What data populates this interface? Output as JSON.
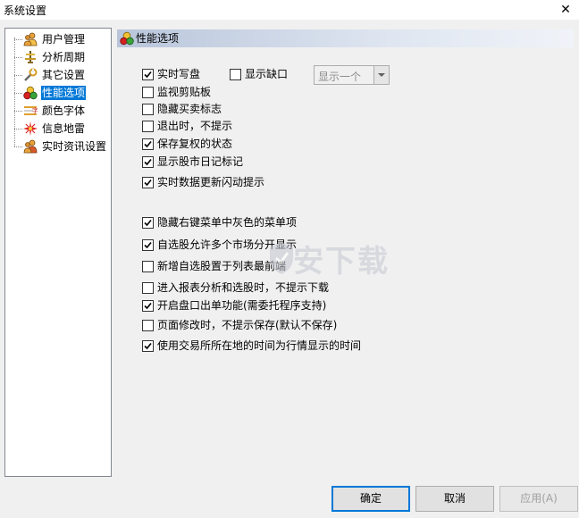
{
  "window": {
    "title": "系统设置",
    "close_label": "✕"
  },
  "tree": {
    "items": [
      {
        "label": "用户管理",
        "icon": "users-icon"
      },
      {
        "label": "分析周期",
        "icon": "cycle-icon"
      },
      {
        "label": "其它设置",
        "icon": "tools-icon"
      },
      {
        "label": "性能选项",
        "icon": "performance-icon",
        "selected": true
      },
      {
        "label": "颜色字体",
        "icon": "font-color-icon"
      },
      {
        "label": "信息地雷",
        "icon": "mine-icon"
      },
      {
        "label": "实时资讯设置",
        "icon": "news-users-icon"
      }
    ]
  },
  "panel": {
    "title": "性能选项"
  },
  "options": {
    "realtime_write": {
      "label": "实时写盘",
      "checked": true
    },
    "show_gaps": {
      "label": "显示缺口",
      "checked": false
    },
    "monitor_clipboard": {
      "label": "监视剪贴板",
      "checked": false
    },
    "hide_buysell": {
      "label": "隐藏买卖标志",
      "checked": false
    },
    "exit_no_prompt": {
      "label": "退出时，不提示",
      "checked": false
    },
    "save_restore_state": {
      "label": "保存复权的状态",
      "checked": true
    },
    "show_diary_mark": {
      "label": "显示股市日记标记",
      "checked": true
    },
    "flash_update": {
      "label": "实时数据更新闪动提示",
      "checked": true
    },
    "hide_gray_menu": {
      "label": "隐藏右键菜单中灰色的菜单项",
      "checked": true
    },
    "multi_market": {
      "label": "自选股允许多个市场分开显示",
      "checked": true
    },
    "new_to_front": {
      "label": "新增自选股置于列表最前端",
      "checked": false
    },
    "no_download_prompt": {
      "label": "进入报表分析和选股时，不提示下载",
      "checked": false
    },
    "order_function": {
      "label": "开启盘口出单功能(需委托程序支持)",
      "checked": true
    },
    "page_no_save": {
      "label": "页面修改时，不提示保存(默认不保存)",
      "checked": false
    },
    "exchange_time": {
      "label": "使用交易所所在地的时间为行情显示的时间",
      "checked": true
    }
  },
  "combo": {
    "value": "显示一个"
  },
  "buttons": {
    "ok": "确定",
    "cancel": "取消",
    "apply": "应用(A)"
  },
  "watermark": {
    "text": "安下载"
  },
  "colors": {
    "accent": "#0078d7",
    "header_gradient_start": "#b8c5da"
  }
}
